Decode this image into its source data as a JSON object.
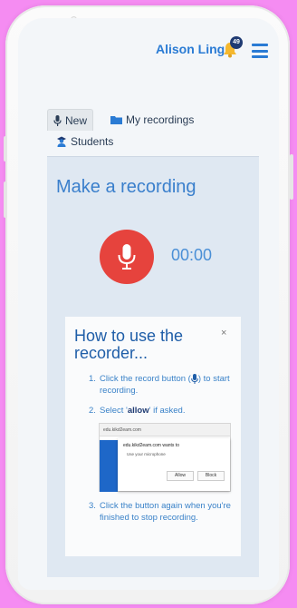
{
  "header": {
    "user_name": "Alison Ling",
    "notification_count": "49"
  },
  "tabs": [
    {
      "label": "New",
      "icon": "microphone-icon",
      "active": true
    },
    {
      "label": "My recordings",
      "icon": "folder-icon",
      "active": false
    },
    {
      "label": "Students",
      "icon": "students-icon",
      "active": false
    }
  ],
  "main": {
    "title": "Make a recording",
    "timer": "00:00"
  },
  "help": {
    "title": "How to use the recorder...",
    "close": "×",
    "step1_num": "1.",
    "step1_pre": "Click the record button (",
    "step1_post": ") to start recording.",
    "step2_num": "2.",
    "step2_pre": "Select '",
    "step2_bold": "allow",
    "step2_post": "' if asked.",
    "step3_num": "3.",
    "step3": "Click the button again when you're finished to stop recording.",
    "screenshot": {
      "url": "edu.kikd2eam.com",
      "prompt": "edu.kikd2eam.com wants to",
      "permission": "Use your microphone",
      "allow": "Allow",
      "block": "Block"
    }
  },
  "colors": {
    "brand_blue": "#2a7bd4",
    "record_red": "#e6433d",
    "bell_yellow": "#f5b82e"
  }
}
